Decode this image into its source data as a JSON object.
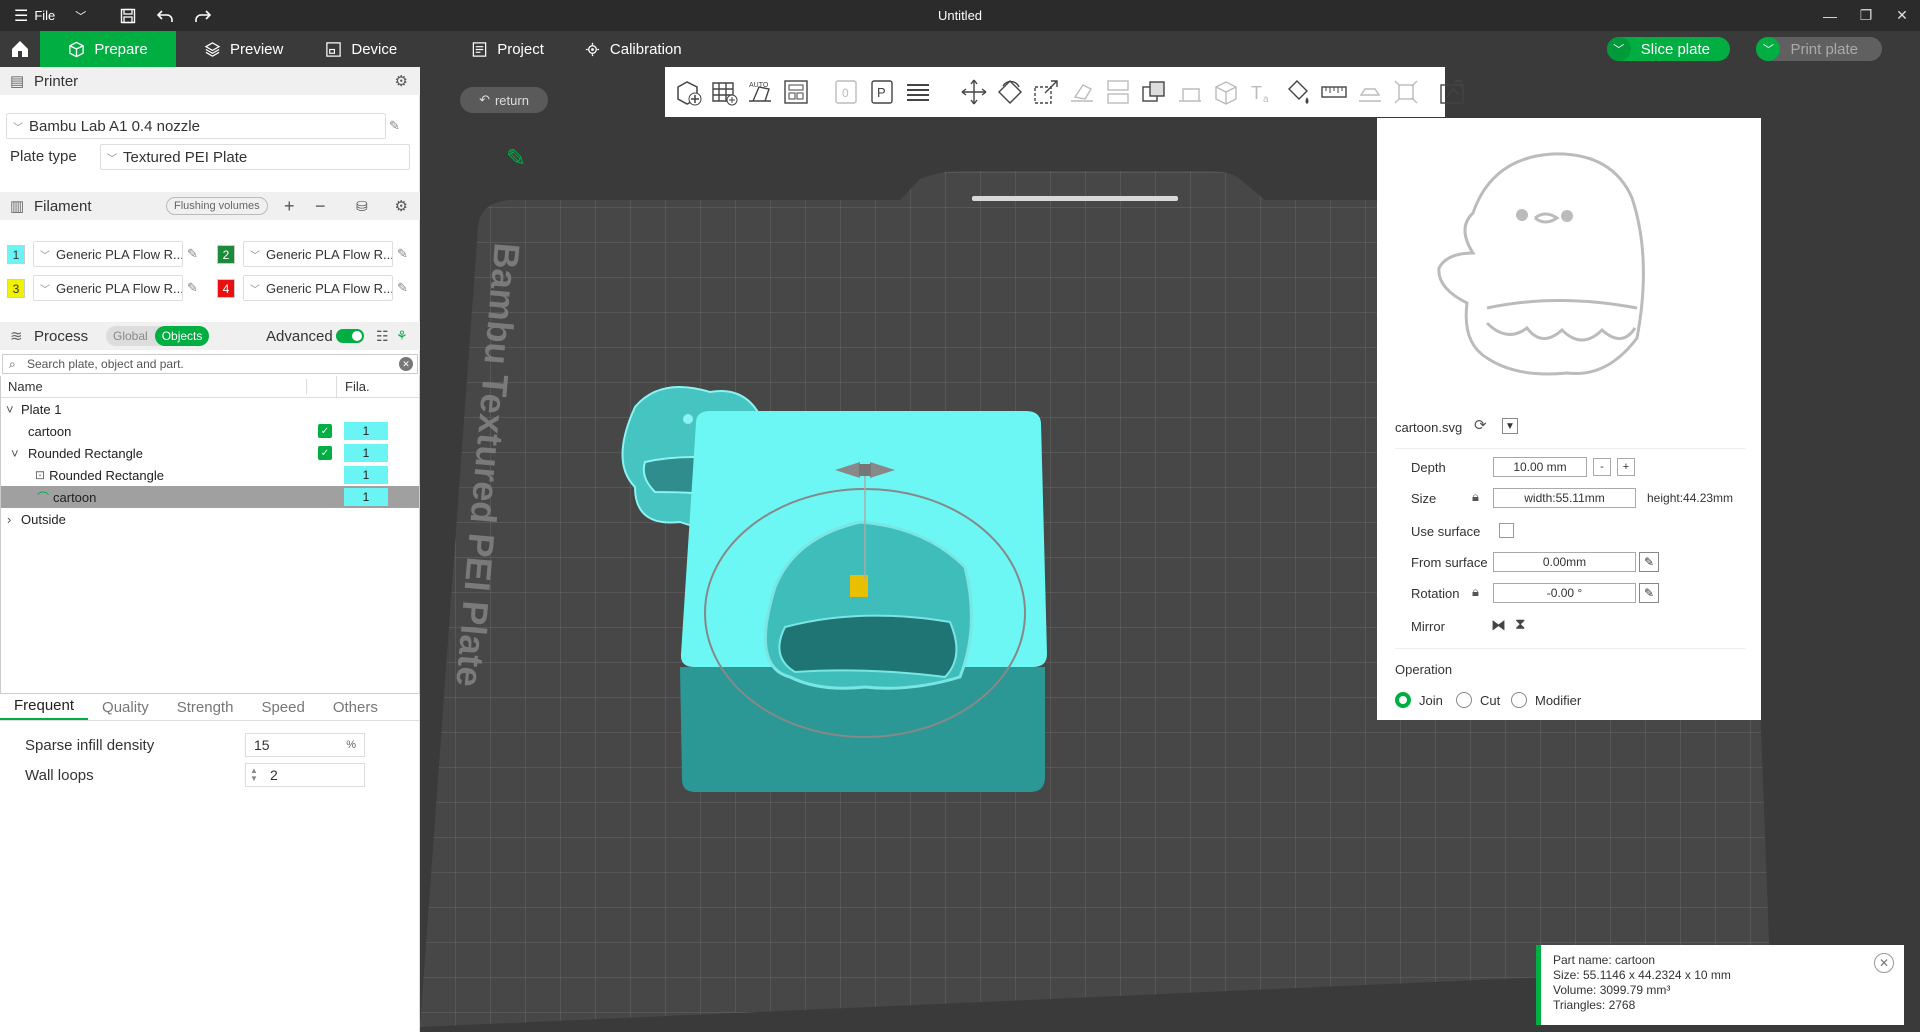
{
  "titlebar": {
    "menu_label": "File",
    "window_title": "Untitled"
  },
  "nav": {
    "tabs": [
      {
        "label": "Prepare",
        "active": true
      },
      {
        "label": "Preview"
      },
      {
        "label": "Device"
      },
      {
        "label": "Project"
      },
      {
        "label": "Calibration"
      }
    ],
    "slice_label": "Slice plate",
    "print_label": "Print plate"
  },
  "printer": {
    "header": "Printer",
    "name": "Bambu Lab A1 0.4 nozzle",
    "plate_type_label": "Plate type",
    "plate_type": "Textured PEI Plate"
  },
  "filament": {
    "header": "Filament",
    "flushing_label": "Flushing volumes",
    "items": [
      {
        "num": "1",
        "color": "#6bf4f4",
        "text_color": "#333",
        "name": "Generic PLA Flow R..."
      },
      {
        "num": "2",
        "color": "#1b8a3a",
        "text_color": "#fff",
        "name": "Generic PLA Flow R..."
      },
      {
        "num": "3",
        "color": "#f2f200",
        "text_color": "#333",
        "name": "Generic PLA Flow R..."
      },
      {
        "num": "4",
        "color": "#e81010",
        "text_color": "#fff",
        "name": "Generic PLA Flow R..."
      }
    ]
  },
  "process": {
    "header": "Process",
    "global_label": "Global",
    "objects_label": "Objects",
    "advanced_label": "Advanced",
    "search_placeholder": "Search plate, object and part.",
    "col_name": "Name",
    "col_fila": "Fila.",
    "tree": [
      {
        "label": "Plate 1",
        "expander": "˅",
        "check": false,
        "fila": ""
      },
      {
        "label": "cartoon",
        "expander": "",
        "check": true,
        "fila": "1"
      },
      {
        "label": "Rounded Rectangle",
        "expander": "˅",
        "check": true,
        "fila": "1"
      },
      {
        "label": "Rounded Rectangle",
        "expander": "",
        "check": false,
        "fila": "1"
      },
      {
        "label": "cartoon",
        "expander": "",
        "check": false,
        "fila": "1",
        "selected": true
      },
      {
        "label": "Outside",
        "expander": "›",
        "check": false,
        "fila": ""
      }
    ],
    "sub_tabs": [
      "Frequent",
      "Quality",
      "Strength",
      "Speed",
      "Others"
    ],
    "params": [
      {
        "label": "Sparse infill density",
        "value": "15",
        "unit": "%"
      },
      {
        "label": "Wall loops",
        "value": "2",
        "unit": ""
      }
    ]
  },
  "viewport": {
    "return_label": "return",
    "plate_text": "Bambu Textured PEI Plate"
  },
  "props": {
    "file_name": "cartoon.svg",
    "depth_label": "Depth",
    "depth_value": "10.00 mm",
    "size_label": "Size",
    "width_value": "width:55.11mm",
    "height_value": "height:44.23mm",
    "use_surface_label": "Use surface",
    "from_surface_label": "From surface",
    "from_surface_value": "0.00mm",
    "rotation_label": "Rotation",
    "rotation_value": "-0.00 °",
    "mirror_label": "Mirror",
    "operation_label": "Operation",
    "operations": [
      "Join",
      "Cut",
      "Modifier"
    ],
    "operation_selected": "Join"
  },
  "info": {
    "part_name": "Part name: cartoon",
    "size": "Size: 55.1146 x 44.2324 x 10 mm",
    "volume": "Volume: 3099.79 mm³",
    "triangles": "Triangles: 2768"
  }
}
